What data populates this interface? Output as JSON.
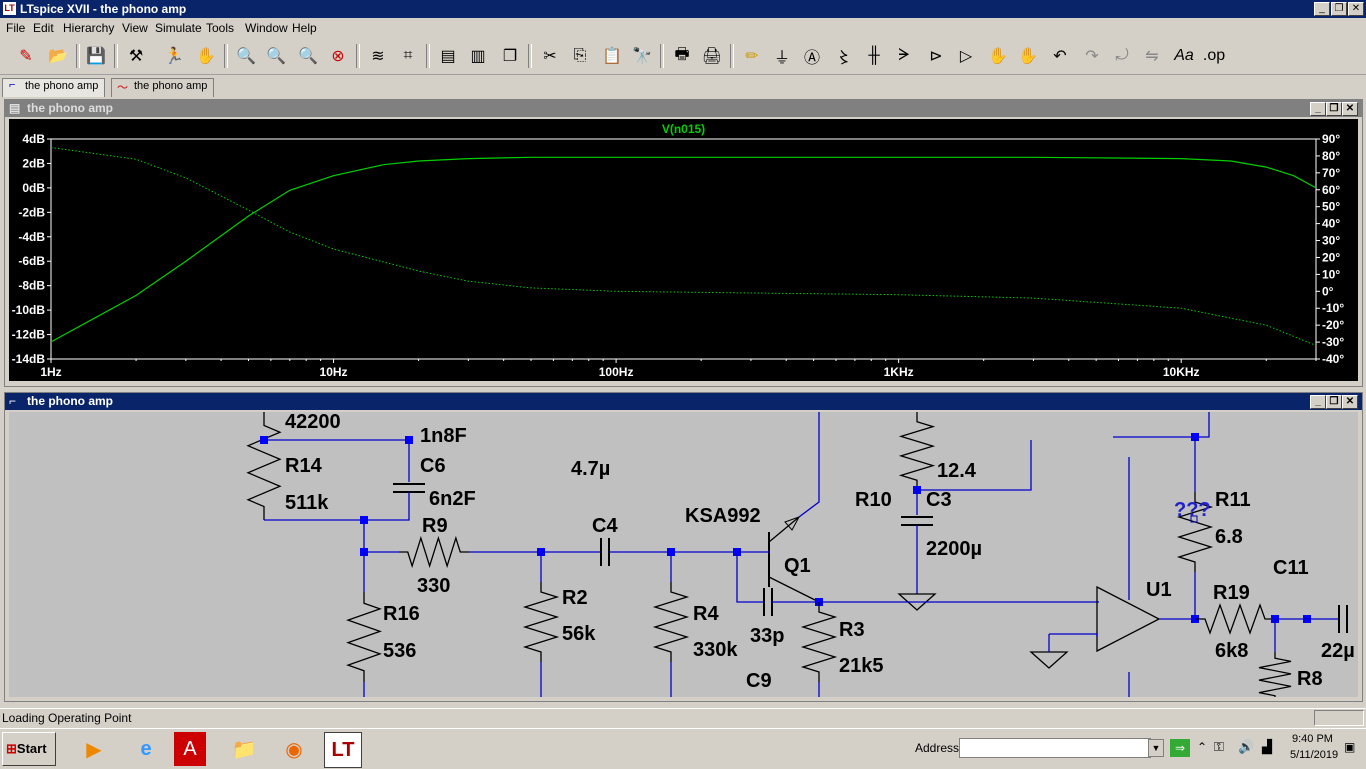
{
  "window": {
    "title": "LTspice XVII - the phono amp"
  },
  "menu": [
    "File",
    "Edit",
    "Hierarchy",
    "View",
    "Simulate",
    "Tools",
    "Window",
    "Help"
  ],
  "tabs": [
    "the phono amp",
    "the phono amp"
  ],
  "waveform_window": {
    "title": "the phono amp",
    "trace_label": "V(n015)"
  },
  "schematic_window": {
    "title": "the phono amp"
  },
  "chart_data": {
    "type": "line",
    "title": "V(n015)",
    "x_scale": "log",
    "xlim": [
      1,
      30000
    ],
    "x_ticks": [
      "1Hz",
      "10Hz",
      "100Hz",
      "1KHz",
      "10KHz"
    ],
    "y_left_ticks": [
      "4dB",
      "2dB",
      "0dB",
      "-2dB",
      "-4dB",
      "-6dB",
      "-8dB",
      "-10dB",
      "-12dB",
      "-14dB"
    ],
    "y_right_ticks": [
      "90°",
      "80°",
      "70°",
      "60°",
      "50°",
      "40°",
      "30°",
      "20°",
      "10°",
      "0°",
      "-10°",
      "-20°",
      "-30°",
      "-40°"
    ],
    "ylim_left": [
      -14,
      4
    ],
    "ylim_right": [
      -40,
      90
    ],
    "series": [
      {
        "name": "V(n015)",
        "axis": "left",
        "style": "solid",
        "x": [
          1,
          2,
          3,
          5,
          7,
          10,
          15,
          20,
          30,
          50,
          100,
          300,
          1000,
          3000,
          10000,
          15000,
          20000,
          25000,
          30000
        ],
        "y": [
          -12.6,
          -8.8,
          -6,
          -2.3,
          -0.2,
          1.0,
          1.9,
          2.2,
          2.4,
          2.5,
          2.5,
          2.5,
          2.5,
          2.5,
          2.4,
          2.2,
          1.7,
          1.0,
          0.0
        ]
      },
      {
        "name": "phase",
        "axis": "right",
        "style": "dotted",
        "x": [
          1,
          2,
          3,
          5,
          7,
          10,
          20,
          30,
          50,
          100,
          300,
          1000,
          3000,
          10000,
          20000,
          30000
        ],
        "y": [
          85,
          78,
          67,
          48,
          35,
          25,
          12,
          6,
          2,
          0,
          -1,
          -2,
          -4,
          -10,
          -20,
          -32
        ]
      }
    ],
    "colors": {
      "trace": "#00d000",
      "background": "#000000",
      "axis_text": "#ffffff"
    }
  },
  "schematic": {
    "labels": [
      "42200",
      "1n8F",
      "R14",
      "C6",
      "511k",
      "6n2F",
      "R9",
      "330",
      "4.7µ",
      "C4",
      "R16",
      "536",
      "R2",
      "56k",
      "R4",
      "330k",
      "KSA992",
      "Q1",
      "33p",
      "C9",
      "R3",
      "21k5",
      "R10",
      "C3",
      "12.4",
      "2200µ",
      "R11",
      "???",
      "6.8",
      "U1",
      "R19",
      "6k8",
      "C11",
      "22µ",
      "R8"
    ],
    "colors": {
      "wire": "#0000cc",
      "node": "#0000ff",
      "background": "#c0c0c0",
      "text": "#000000"
    }
  },
  "status": {
    "text": "Loading Operating Point"
  },
  "taskbar": {
    "start": "Start",
    "address_label": "Address",
    "time": "9:40 PM",
    "date": "5/11/2019"
  }
}
